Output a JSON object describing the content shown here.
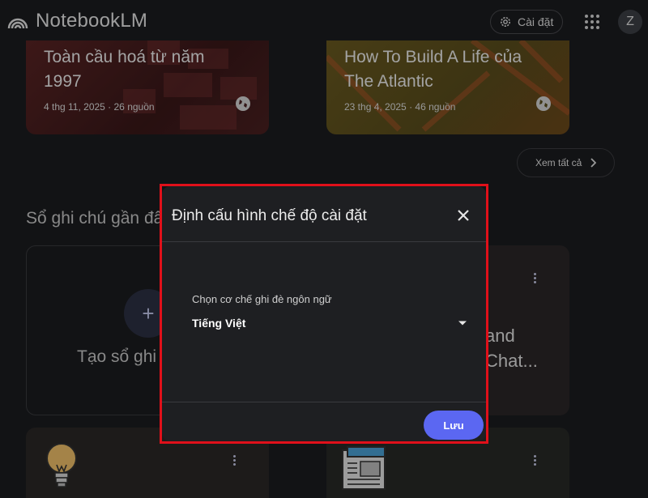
{
  "app": {
    "title": "NotebookLM",
    "avatar_initial": "Z"
  },
  "header": {
    "settings_label": "Cài đặt"
  },
  "featured": [
    {
      "title": "Toàn cầu hoá từ năm 1997",
      "meta": "4 thg 11, 2025 · 26 nguồn"
    },
    {
      "title": "How To Build A Life của The Atlantic",
      "meta": "23 thg 4, 2025 · 46 nguồn"
    }
  ],
  "see_all_label": "Xem tất cả",
  "recent": {
    "section_title": "Sổ ghi chú gần đây",
    "create_label": "Tạo sổ ghi chú mới",
    "card_title_partial": "and\nChat..."
  },
  "dialog": {
    "title": "Định cấu hình chế độ cài đặt",
    "field_label": "Chọn cơ chế ghi đè ngôn ngữ",
    "selected_value": "Tiếng Việt",
    "save_label": "Lưu"
  },
  "colors": {
    "accent": "#5b67f2",
    "highlight_border": "#e0101a",
    "background": "#1b1c1f"
  }
}
